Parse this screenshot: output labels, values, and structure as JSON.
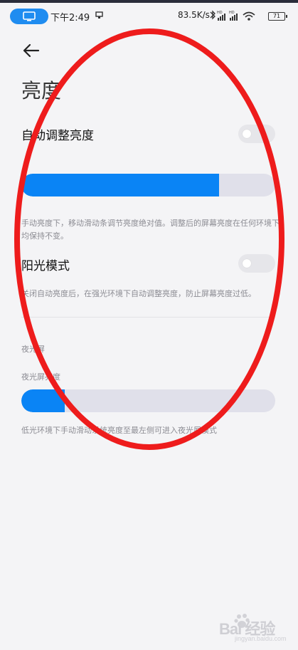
{
  "status_bar": {
    "time": "下午2:49",
    "net_speed": "83.5K/s",
    "battery": "71"
  },
  "page": {
    "title": "亮度"
  },
  "auto_brightness": {
    "label": "自动调整亮度",
    "enabled": false
  },
  "brightness_slider": {
    "value": 0.78,
    "help": "手动亮度下，移动滑动条调节亮度绝对值。调整后的屏幕亮度在任何环境下均保持不变。"
  },
  "sunlight_mode": {
    "label": "阳光模式",
    "enabled": false,
    "help": "关闭自动亮度后，在强光环境下自动调整亮度，防止屏幕亮度过低。"
  },
  "night_light": {
    "section_title": "夜光屏",
    "slider_label": "夜光屏亮度",
    "value": 0.17,
    "help": "低光环境下手动滑动系统亮度至最左侧可进入夜光屏模式"
  },
  "watermark": {
    "brand": "Bai 经验",
    "site": "jingyan.baidu.com"
  },
  "colors": {
    "accent": "#0a84f5",
    "toggle_off": "#e6e6ea",
    "annotation": "#ee1c1c"
  }
}
